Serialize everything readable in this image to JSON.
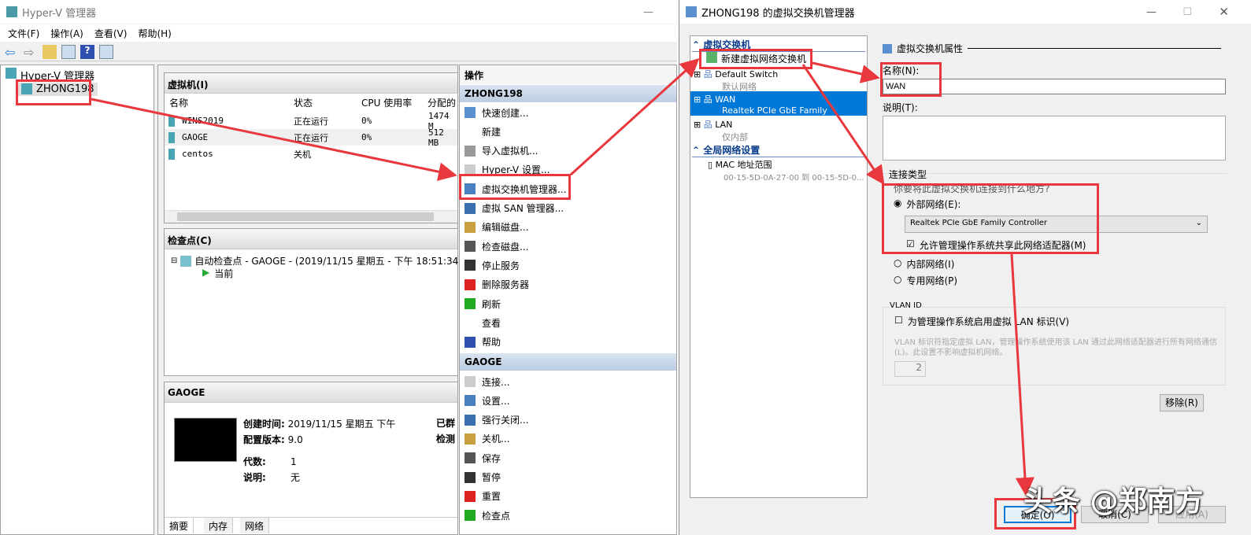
{
  "main_window": {
    "title": "Hyper-V 管理器",
    "menu": [
      "文件(F)",
      "操作(A)",
      "查看(V)",
      "帮助(H)"
    ],
    "tree": {
      "root": "Hyper-V 管理器",
      "server": "ZHONG198"
    },
    "vm_pane": {
      "title": "虚拟机(I)",
      "columns": [
        "名称",
        "状态",
        "CPU 使用率",
        "分配的"
      ],
      "rows": [
        {
          "name": "WINS2019",
          "state": "正在运行",
          "cpu": "0%",
          "mem": "1474 M"
        },
        {
          "name": "GAOGE",
          "state": "正在运行",
          "cpu": "0%",
          "mem": "512 MB"
        },
        {
          "name": "centos",
          "state": "关机",
          "cpu": "",
          "mem": ""
        }
      ]
    },
    "checkpoint_pane": {
      "title": "检查点(C)",
      "checkpoint": "自动检查点 - GAOGE - (2019/11/15 星期五 - 下午 18:51:34",
      "current": "当前"
    },
    "details_pane": {
      "title": "GAOGE",
      "created_label": "创建时间:",
      "created": "2019/11/15 星期五 下午",
      "config_label": "配置版本:",
      "config": "9.0",
      "gen_label": "代数:",
      "gen": "1",
      "desc_label": "说明:",
      "desc": "无",
      "right1": "已群",
      "right2": "检测",
      "tabs": [
        "摘要",
        "内存",
        "网络"
      ]
    },
    "actions": {
      "title": "操作",
      "server_section": "ZHONG198",
      "server_items": [
        "快速创建...",
        "新建",
        "导入虚拟机...",
        "Hyper-V 设置...",
        "虚拟交换机管理器...",
        "虚拟 SAN 管理器...",
        "编辑磁盘...",
        "检查磁盘...",
        "停止服务",
        "删除服务器",
        "刷新",
        "查看",
        "帮助"
      ],
      "vm_section": "GAOGE",
      "vm_items": [
        "连接...",
        "设置...",
        "强行关闭...",
        "关机...",
        "保存",
        "暂停",
        "重置",
        "检查点"
      ]
    }
  },
  "dialog": {
    "title": "ZHONG198 的虚拟交换机管理器",
    "list": {
      "section1": "虚拟交换机",
      "new": "新建虚拟网络交换机",
      "switches": [
        {
          "name": "Default Switch",
          "sub": "默认网络"
        },
        {
          "name": "WAN",
          "sub": "Realtek PCIe GbE Family Controller"
        },
        {
          "name": "LAN",
          "sub": "仅内部"
        }
      ],
      "section2": "全局网络设置",
      "mac_label": "MAC 地址范围",
      "mac_value": "00-15-5D-0A-27-00 到 00-15-5D-0..."
    },
    "props": {
      "header": "虚拟交换机属性",
      "name_label": "名称(N):",
      "name_value": "WAN",
      "desc_label": "说明(T):",
      "conn_type": "连接类型",
      "conn_question": "你要将此虚拟交换机连接到什么地方?",
      "external": "外部网络(E):",
      "adapter": "Realtek PCIe GbE Family Controller",
      "allow_share": "允许管理操作系统共享此网络适配器(M)",
      "internal": "内部网络(I)",
      "private": "专用网络(P)",
      "vlan_title": "VLAN ID",
      "vlan_check": "为管理操作系统启用虚拟 LAN 标识(V)",
      "vlan_help": "VLAN 标识符指定虚拟 LAN，管理操作系统使用该 LAN 通过此网络适配器进行所有网络通信(L)。此设置不影响虚拟机网络。",
      "vlan_value": "2",
      "remove": "移除(R)"
    },
    "buttons": {
      "ok": "确定(O)",
      "cancel": "取消(C)",
      "apply": "应用(A)"
    }
  },
  "watermark": "头条 @郑南方",
  "colors": {
    "annotation": "#e8383d",
    "selection": "#0078d7",
    "section_header": "#c8d6e8"
  }
}
